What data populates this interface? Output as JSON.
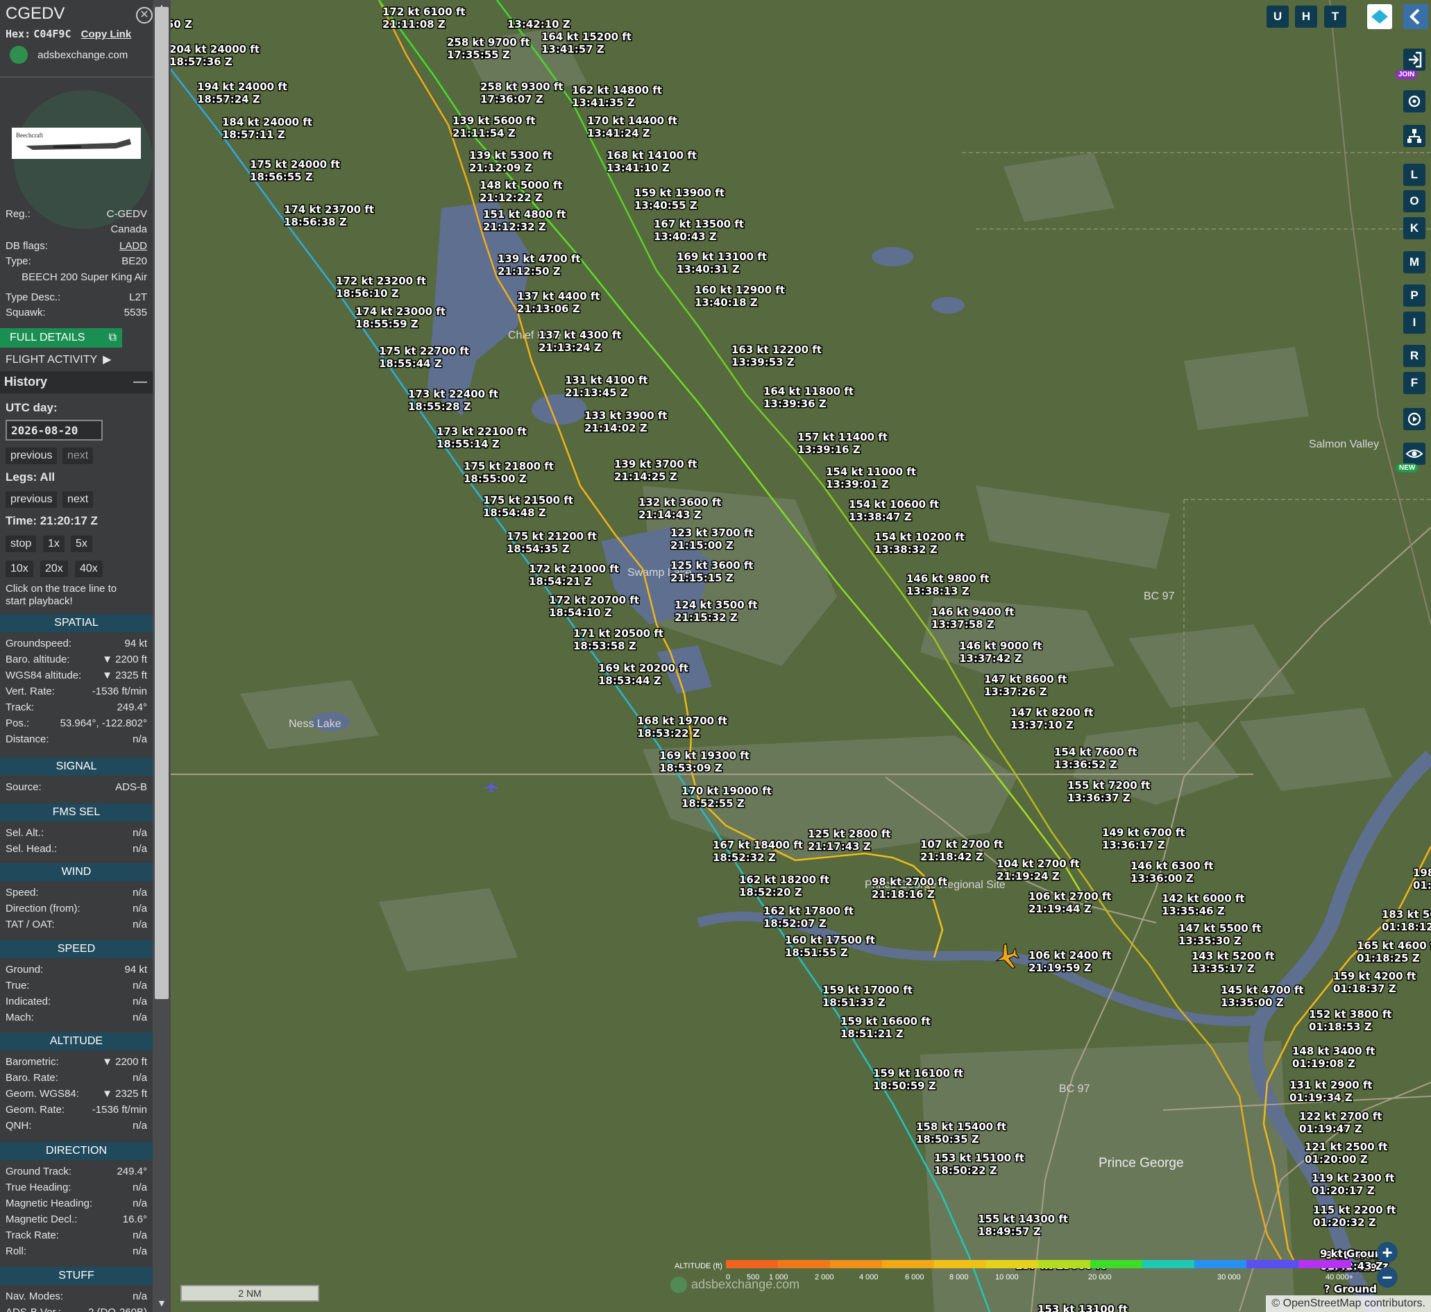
{
  "sidebar": {
    "callsign": "CGEDV",
    "hex_label": "Hex:",
    "hex": "C04F9C",
    "copy_link": "Copy Link",
    "site": "adsbexchange.com",
    "reg_label": "Reg.:",
    "reg": "C-GEDV",
    "country": "Canada",
    "dbflags_label": "DB flags:",
    "dbflags": "LADD",
    "type_label": "Type:",
    "type": "BE20",
    "model": "BEECH 200 Super King Air",
    "typedesc_label": "Type Desc.:",
    "typedesc": "L2T",
    "squawk_label": "Squawk:",
    "squawk": "5535",
    "full_details": "FULL DETAILS",
    "flight_activity": "FLIGHT ACTIVITY",
    "history": "History",
    "utc_day_label": "UTC day:",
    "utc_day": "2026-08-20",
    "previous": "previous",
    "next": "next",
    "legs": "Legs: All",
    "time": "Time: 21:20:17 Z",
    "speeds": [
      "stop",
      "1x",
      "5x",
      "10x",
      "20x",
      "40x"
    ],
    "click_hint": "Click on the trace line to start playback!",
    "spatial": {
      "title": "SPATIAL",
      "rows": [
        {
          "k": "Groundspeed:",
          "v": "94 kt"
        },
        {
          "k": "Baro. altitude:",
          "v": "▼ 2200 ft"
        },
        {
          "k": "WGS84 altitude:",
          "v": "▼ 2325 ft"
        },
        {
          "k": "Vert. Rate:",
          "v": "-1536 ft/min"
        },
        {
          "k": "Track:",
          "v": "249.4°"
        },
        {
          "k": "Pos.:",
          "v": "53.964°, -122.802°"
        },
        {
          "k": "Distance:",
          "v": "n/a"
        }
      ]
    },
    "signal": {
      "title": "SIGNAL",
      "rows": [
        {
          "k": "Source:",
          "v": "ADS-B"
        }
      ]
    },
    "fms": {
      "title": "FMS SEL",
      "rows": [
        {
          "k": "Sel. Alt.:",
          "v": "n/a"
        },
        {
          "k": "Sel. Head.:",
          "v": "n/a"
        }
      ]
    },
    "wind": {
      "title": "WIND",
      "rows": [
        {
          "k": "Speed:",
          "v": "n/a"
        },
        {
          "k": "Direction (from):",
          "v": "n/a"
        },
        {
          "k": "TAT / OAT:",
          "v": "n/a"
        }
      ]
    },
    "speed": {
      "title": "SPEED",
      "rows": [
        {
          "k": "Ground:",
          "v": "94 kt"
        },
        {
          "k": "True:",
          "v": "n/a"
        },
        {
          "k": "Indicated:",
          "v": "n/a"
        },
        {
          "k": "Mach:",
          "v": "n/a"
        }
      ]
    },
    "altitude": {
      "title": "ALTITUDE",
      "rows": [
        {
          "k": "Barometric:",
          "v": "▼ 2200 ft"
        },
        {
          "k": "Baro. Rate:",
          "v": "n/a"
        },
        {
          "k": "Geom. WGS84:",
          "v": "▼ 2325 ft"
        },
        {
          "k": "Geom. Rate:",
          "v": "-1536 ft/min"
        },
        {
          "k": "QNH:",
          "v": "n/a"
        }
      ]
    },
    "direction": {
      "title": "DIRECTION",
      "rows": [
        {
          "k": "Ground Track:",
          "v": "249.4°"
        },
        {
          "k": "True Heading:",
          "v": "n/a"
        },
        {
          "k": "Magnetic Heading:",
          "v": "n/a"
        },
        {
          "k": "Magnetic Decl.:",
          "v": "16.6°"
        },
        {
          "k": "Track Rate:",
          "v": "n/a"
        },
        {
          "k": "Roll:",
          "v": "n/a"
        }
      ]
    },
    "stuff": {
      "title": "STUFF",
      "rows": [
        {
          "k": "Nav. Modes:",
          "v": "n/a"
        },
        {
          "k": "ADS-B Ver.:",
          "v": "2 (DO-260B)"
        }
      ]
    }
  },
  "map": {
    "places": [
      "Salmon Valley",
      "Prince George",
      "Ness Lake",
      "Chief Lake",
      "Swamp Lake",
      "BC 97",
      "BC 97",
      "Prince George Regional Site"
    ],
    "right_buttons": [
      "U",
      "H",
      "T",
      "L",
      "O",
      "K",
      "M",
      "P",
      "I",
      "R",
      "F"
    ],
    "join_badge": "JOIN",
    "new_badge": "NEW",
    "scale": "2 NM",
    "attribution": "© OpenStreetMap contributors.",
    "watermark": "adsbexchange.com",
    "legend_title": "ALTITUDE (ft)",
    "legend_ticks": [
      "0",
      "500",
      "1 000",
      "2 000",
      "4 000",
      "6 000",
      "8 000",
      "10 000",
      "20 000",
      "30 000",
      "40 000+"
    ],
    "legend_colors": [
      "#f0641e",
      "#f07818",
      "#f09018",
      "#f0a818",
      "#f0c018",
      "#e6d21a",
      "#b4dc1e",
      "#3cdc28",
      "#1ec8b4",
      "#2890f0",
      "#5a50f0",
      "#b432f0"
    ]
  },
  "traces": [
    {
      "color_from": "#f0a818",
      "color_to": "#f0a818",
      "labels": [
        [
          "172 kt  6100 ft",
          "21:11:08 Z"
        ],
        [
          "139 kt  5600 ft",
          "21:11:54 Z"
        ],
        [
          "139 kt  5300 ft",
          "21:12:09 Z"
        ],
        [
          "148 kt  5000 ft",
          "21:12:22 Z"
        ],
        [
          "151 kt  4800 ft",
          "21:12:32 Z"
        ],
        [
          "139 kt  4700 ft",
          "21:12:50 Z"
        ],
        [
          "137 kt  4400 ft",
          "21:13:06 Z"
        ],
        [
          "137 kt  4300 ft",
          "21:13:24 Z"
        ],
        [
          "131 kt  4100 ft",
          "21:13:45 Z"
        ],
        [
          "133 kt  3900 ft",
          "21:14:02 Z"
        ],
        [
          "139 kt  3700 ft",
          "21:14:25 Z"
        ],
        [
          "132 kt  3600 ft",
          "21:14:43 Z"
        ],
        [
          "123 kt  3700 ft",
          "21:15:00 Z"
        ],
        [
          "125 kt  3600 ft",
          "21:15:15 Z"
        ],
        [
          "124 kt  3500 ft",
          "21:15:32 Z"
        ],
        [
          "125 kt  2800 ft",
          "21:17:43 Z"
        ],
        [
          "98 kt  2700 ft",
          "21:18:16 Z"
        ],
        [
          "107 kt  2700 ft",
          "21:18:42 Z"
        ],
        [
          "104 kt  2700 ft",
          "21:19:24 Z"
        ],
        [
          "106 kt  2700 ft",
          "21:19:44 Z"
        ],
        [
          "106 kt  2400 ft",
          "21:19:59 Z"
        ]
      ]
    },
    {
      "labels": [
        [
          "204 kt  24000 ft",
          "18:57:36 Z"
        ],
        [
          "194 kt  24000 ft",
          "18:57:24 Z"
        ],
        [
          "184 kt  24000 ft",
          "18:57:11 Z"
        ],
        [
          "175 kt  24000 ft",
          "18:56:55 Z"
        ],
        [
          "174 kt  23700 ft",
          "18:56:38 Z"
        ],
        [
          "172 kt  23200 ft",
          "18:56:10 Z"
        ],
        [
          "174 kt  23000 ft",
          "18:55:59 Z"
        ],
        [
          "175 kt  22700 ft",
          "18:55:44 Z"
        ],
        [
          "173 kt  22400 ft",
          "18:55:28 Z"
        ],
        [
          "173 kt  22100 ft",
          "18:55:14 Z"
        ],
        [
          "175 kt  21800 ft",
          "18:55:00 Z"
        ],
        [
          "175 kt  21500 ft",
          "18:54:48 Z"
        ],
        [
          "175 kt  21200 ft",
          "18:54:35 Z"
        ],
        [
          "172 kt  21000 ft",
          "18:54:21 Z"
        ],
        [
          "172 kt  20700 ft",
          "18:54:10 Z"
        ],
        [
          "171 kt  20500 ft",
          "18:53:58 Z"
        ],
        [
          "169 kt  20200 ft",
          "18:53:44 Z"
        ],
        [
          "168 kt  19700 ft",
          "18:53:22 Z"
        ],
        [
          "169 kt  19300 ft",
          "18:53:09 Z"
        ],
        [
          "170 kt  19000 ft",
          "18:52:55 Z"
        ],
        [
          "167 kt  18400 ft",
          "18:52:32 Z"
        ],
        [
          "162 kt  18200 ft",
          "18:52:20 Z"
        ],
        [
          "162 kt  17800 ft",
          "18:52:07 Z"
        ],
        [
          "160 kt  17500 ft",
          "18:51:55 Z"
        ],
        [
          "159 kt  17000 ft",
          "18:51:33 Z"
        ],
        [
          "159 kt  16600 ft",
          "18:51:21 Z"
        ],
        [
          "159 kt  16100 ft",
          "18:50:59 Z"
        ],
        [
          "158 kt  15400 ft",
          "18:50:35 Z"
        ],
        [
          "153 kt  15100 ft",
          "18:50:22 Z"
        ],
        [
          "155 kt  14300 ft",
          "18:49:57 Z"
        ],
        [
          "157 kt  13600 ft",
          ""
        ],
        [
          "153 kt  13100 ft",
          "18:49:18 Z"
        ]
      ]
    },
    {
      "labels": [
        [
          "258 kt  9700 ft",
          "17:35:55 Z"
        ],
        [
          "258 kt  9300 ft",
          "17:36:07 Z"
        ]
      ]
    },
    {
      "labels": [
        [
          "",
          "13:42:10 Z"
        ],
        [
          "164 kt  15200 ft",
          "13:41:57 Z"
        ],
        [
          "162 kt  14800 ft",
          "13:41:35 Z"
        ],
        [
          "170 kt  14400 ft",
          "13:41:24 Z"
        ],
        [
          "168 kt  14100 ft",
          "13:41:10 Z"
        ],
        [
          "159 kt  13900 ft",
          "13:40:55 Z"
        ],
        [
          "167 kt  13500 ft",
          "13:40:43 Z"
        ],
        [
          "169 kt  13100 ft",
          "13:40:31 Z"
        ],
        [
          "160 kt  12900 ft",
          "13:40:18 Z"
        ],
        [
          "163 kt  12200 ft",
          "13:39:53 Z"
        ],
        [
          "164 kt  11800 ft",
          "13:39:36 Z"
        ],
        [
          "157 kt  11400 ft",
          "13:39:16 Z"
        ],
        [
          "154 kt  11000 ft",
          "13:39:01 Z"
        ],
        [
          "154 kt  10600 ft",
          "13:38:47 Z"
        ],
        [
          "154 kt  10200 ft",
          "13:38:32 Z"
        ],
        [
          "146 kt  9800 ft",
          "13:38:13 Z"
        ],
        [
          "146 kt  9400 ft",
          "13:37:58 Z"
        ],
        [
          "146 kt  9000 ft",
          "13:37:42 Z"
        ],
        [
          "147 kt  8600 ft",
          "13:37:26 Z"
        ],
        [
          "147 kt  8200 ft",
          "13:37:10 Z"
        ],
        [
          "154 kt  7600 ft",
          "13:36:52 Z"
        ],
        [
          "155 kt  7200 ft",
          "13:36:37 Z"
        ],
        [
          "149 kt  6700 ft",
          "13:36:17 Z"
        ],
        [
          "146 kt  6300 ft",
          "13:36:00 Z"
        ],
        [
          "142 kt  6000 ft",
          "13:35:46 Z"
        ],
        [
          "147 kt  5500 ft",
          "13:35:30 Z"
        ],
        [
          "143 kt  5200 ft",
          "13:35:17 Z"
        ],
        [
          "145 kt  4700 ft",
          "13:35:00 Z"
        ],
        [
          "9 kt  Ground",
          "13:28:19 Z"
        ],
        [
          "? Ground",
          ""
        ]
      ]
    },
    {
      "labels": [
        [
          "198",
          "01:1"
        ],
        [
          "183 kt  50",
          "01:18:12"
        ],
        [
          "165 kt  4600 ft",
          "01:18:25 Z"
        ],
        [
          "159 kt  4200 ft",
          "01:18:37 Z"
        ],
        [
          "152 kt  3800 ft",
          "01:18:53 Z"
        ],
        [
          "148 kt  3400 ft",
          "01:19:08 Z"
        ],
        [
          "131 kt  2900 ft",
          "01:19:34 Z"
        ],
        [
          "122 kt  2700 ft",
          "01:19:47 Z"
        ],
        [
          "121 kt  2500 ft",
          "01:20:00 Z"
        ],
        [
          "119 kt  2300 ft",
          "01:20:17 Z"
        ],
        [
          "115 kt  2200 ft",
          "01:20:32 Z"
        ],
        [
          "9 kt  Ground",
          "01:42:43 Z"
        ]
      ]
    },
    {
      "labels": [
        [
          "",
          "50 Z"
        ]
      ]
    }
  ]
}
